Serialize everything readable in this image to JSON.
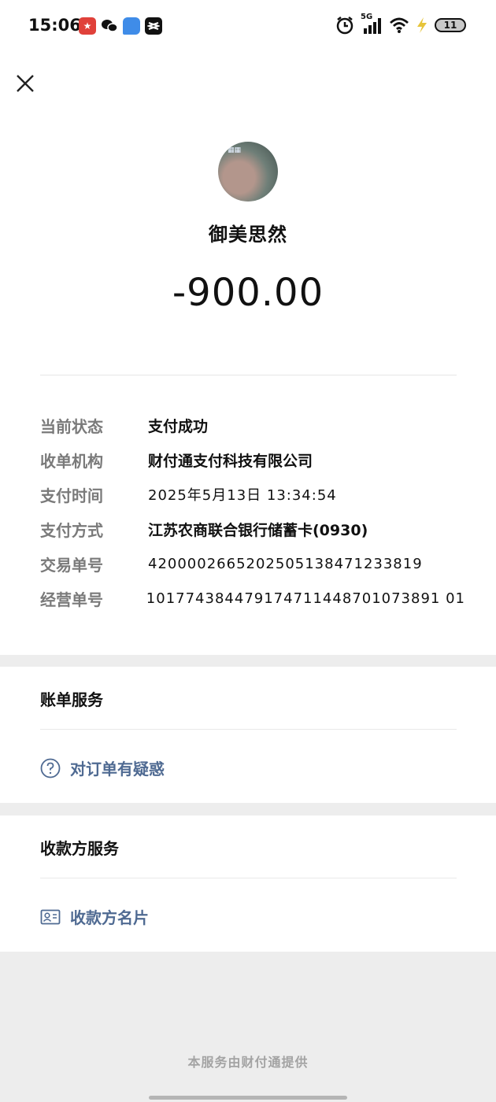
{
  "status_bar": {
    "time": "15:06",
    "network": "5G",
    "battery": "11",
    "icons": [
      "app-red-icon",
      "wechat-icon",
      "app-blue-icon",
      "capcut-icon",
      "alarm-icon",
      "signal-icon",
      "wifi-icon",
      "charging-icon"
    ]
  },
  "header": {
    "close_icon": "close-icon"
  },
  "merchant": {
    "name": "御美思然"
  },
  "amount": "-900.00",
  "details": [
    {
      "label": "当前状态",
      "value": "支付成功"
    },
    {
      "label": "收单机构",
      "value": "财付通支付科技有限公司"
    },
    {
      "label": "支付时间",
      "value": "2025年5月13日 13:34:54"
    },
    {
      "label": "支付方式",
      "value": "江苏农商联合银行储蓄卡(0930)"
    },
    {
      "label": "交易单号",
      "value": "4200002665202505138471233819"
    },
    {
      "label": "经营单号",
      "value": "101774384479174711448701073891 01"
    }
  ],
  "bill_service": {
    "title": "账单服务",
    "action": "对订单有疑惑",
    "icon": "question-icon"
  },
  "payee_service": {
    "title": "收款方服务",
    "action": "收款方名片",
    "icon": "contact-card-icon"
  },
  "footer": "本服务由财付通提供",
  "colors": {
    "link": "#4f6a92",
    "label": "#7a7a7a",
    "background": "#ededed"
  }
}
